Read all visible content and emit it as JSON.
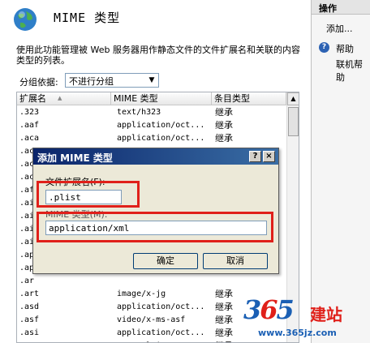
{
  "page": {
    "title": "MIME 类型",
    "description": "使用此功能管理被 Web 服务器用作静态文件的文件扩展名和关联的内容类型的列表。",
    "group_by_label": "分组依据:",
    "group_by_value": "不进行分组"
  },
  "list": {
    "columns": [
      "扩展名",
      "MIME 类型",
      "条目类型"
    ],
    "rows": [
      {
        "ext": ".323",
        "mime": "text/h323",
        "type": "继承"
      },
      {
        "ext": ".aaf",
        "mime": "application/oct...",
        "type": "继承"
      },
      {
        "ext": ".aca",
        "mime": "application/oct...",
        "type": "继承"
      },
      {
        "ext": ".ac",
        "mime": "",
        "type": ""
      },
      {
        "ext": ".ac",
        "mime": "",
        "type": ""
      },
      {
        "ext": ".ac",
        "mime": "",
        "type": ""
      },
      {
        "ext": ".af",
        "mime": "",
        "type": ""
      },
      {
        "ext": ".ai",
        "mime": "",
        "type": ""
      },
      {
        "ext": ".ai",
        "mime": "",
        "type": ""
      },
      {
        "ext": ".ai",
        "mime": "",
        "type": ""
      },
      {
        "ext": ".ai",
        "mime": "",
        "type": ""
      },
      {
        "ext": ".ap",
        "mime": "",
        "type": ""
      },
      {
        "ext": ".ap",
        "mime": "",
        "type": ""
      },
      {
        "ext": ".ar",
        "mime": "",
        "type": ""
      },
      {
        "ext": ".art",
        "mime": "image/x-jg",
        "type": "继承"
      },
      {
        "ext": ".asd",
        "mime": "application/oct...",
        "type": "继承"
      },
      {
        "ext": ".asf",
        "mime": "video/x-ms-asf",
        "type": "继承"
      },
      {
        "ext": ".asi",
        "mime": "application/oct...",
        "type": "继承"
      },
      {
        "ext": ".asm",
        "mime": "text/plain",
        "type": "继承"
      }
    ]
  },
  "actions": {
    "header": "操作",
    "add": "添加...",
    "help": "帮助",
    "online_help": "联机帮助"
  },
  "dialog": {
    "title": "添加 MIME 类型",
    "help_btn": "?",
    "close_btn": "×",
    "ext_label": "文件扩展名(F):",
    "ext_value": ".plist",
    "mime_label": "MIME 类型(M):",
    "mime_value": "application/xml",
    "ok": "确定",
    "cancel": "取消"
  },
  "watermark": {
    "logo_a": "3",
    "logo_b": "6",
    "logo_c": "5",
    "logo_cn": "建站",
    "url": "www.365jz.com"
  },
  "colors": {
    "highlight": "#e0201a",
    "title_bar": "#0a246a"
  }
}
